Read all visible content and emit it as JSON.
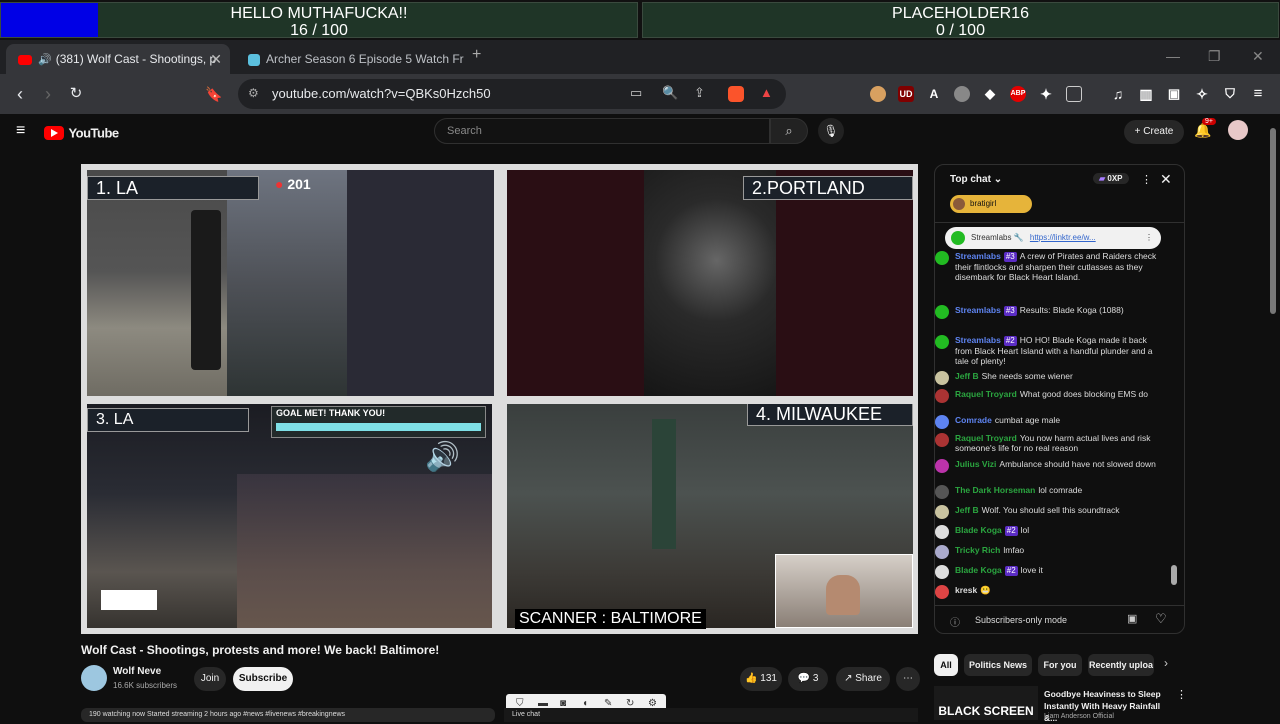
{
  "goals": [
    {
      "title": "HELLO MUTHAFUCKA!!",
      "progress": "16 / 100",
      "fraction": 0.16
    },
    {
      "title": "PLACEHOLDER16",
      "progress": "0 / 100",
      "fraction": 0.0
    }
  ],
  "tabs": [
    {
      "label": "(381) Wolf Cast - Shootings, p",
      "active": true
    },
    {
      "label": "Archer Season 6 Episode 5 Watch Fre",
      "active": false
    }
  ],
  "tab_new": "+",
  "window_controls": {
    "minimize": "—",
    "restore": "❐",
    "close": "✕"
  },
  "address": {
    "url": "youtube.com/watch?v=QBKs0Hzch50"
  },
  "extension_labels": {
    "ublock": "UD",
    "abp": "ABP"
  },
  "youtube": {
    "logo_text": "YouTube",
    "search_placeholder": "Search",
    "create_label": "Create",
    "notifications_badge": "9+"
  },
  "video": {
    "quadrants": [
      {
        "label": "1. LA",
        "viewer_count": "201"
      },
      {
        "label": "2.PORTLAND"
      },
      {
        "label": "3. LA",
        "goal_banner": "GOAL MET! THANK YOU!"
      },
      {
        "label": "4. MILWAUKEE"
      }
    ],
    "scanner_text": "SCANNER : BALTIMORE",
    "title": "Wolf Cast - Shootings, protests and more! We back! Baltimore!"
  },
  "channel": {
    "name": "Wolf Neve",
    "subscribers": "16.6K subscribers",
    "join_label": "Join",
    "subscribe_label": "Subscribe"
  },
  "actions": {
    "likes": "131",
    "comments": "3",
    "share_label": "Share"
  },
  "description_preview": "190 watching now  Started streaming 2 hours ago  #news #livenews #breakingnews",
  "live_chat_tab": "Live chat",
  "chat": {
    "header": "Top chat",
    "points": "0XP",
    "pinned_user": "bratigirl",
    "pinned_message": {
      "author": "Streamlabs",
      "text": "https://linktr.ee/w..."
    },
    "messages": [
      {
        "author": "Streamlabs",
        "badge": "#3",
        "text": "A crew of Pirates and Raiders check their flintlocks and sharpen their cutlasses as they disembark for Black Heart Island.",
        "color": "blue"
      },
      {
        "author": "Streamlabs",
        "badge": "#3",
        "text": "Results: Blade Koga (1088)",
        "color": "blue"
      },
      {
        "author": "Streamlabs",
        "badge": "#2",
        "text": "HO HO! Blade Koga made it back from Black Heart Island with a handful plunder and a tale of plenty!",
        "color": "blue"
      },
      {
        "author": "Jeff B",
        "badge": "",
        "text": "She needs some wiener",
        "color": "green"
      },
      {
        "author": "Raquel Troyard",
        "badge": "",
        "text": "What good does blocking EMS do",
        "color": "green"
      },
      {
        "author": "Comrade",
        "badge": "",
        "text": "cumbat age male",
        "color": "blue"
      },
      {
        "author": "Raquel Troyard",
        "badge": "",
        "text": "You now harm actual lives and risk someone's life for no real reason",
        "color": "green"
      },
      {
        "author": "Julius Vizi",
        "badge": "",
        "text": "Ambulance should have not slowed down",
        "color": "green"
      },
      {
        "author": "The Dark Horseman",
        "badge": "",
        "text": "lol comrade",
        "color": "green"
      },
      {
        "author": "Jeff B",
        "badge": "",
        "text": "Wolf. You should sell this soundtrack",
        "color": "green"
      },
      {
        "author": "Blade Koga",
        "badge": "#2",
        "text": "lol",
        "color": "green"
      },
      {
        "author": "Tricky Rich",
        "badge": "",
        "text": "lmfao",
        "color": "green"
      },
      {
        "author": "Blade Koga",
        "badge": "#2",
        "text": "love it",
        "color": "green"
      },
      {
        "author": "kresk",
        "badge": "",
        "text": "😬",
        "color": "plain"
      }
    ],
    "footer": "Subscribers-only mode"
  },
  "chips": [
    "All",
    "Politics News",
    "For you",
    "Recently uploa"
  ],
  "recommendation": {
    "title": "Goodbye Heaviness to Sleep Instantly With Heavy Rainfall &...",
    "channel": "Liam Anderson Official",
    "thumb_text": "BLACK SCREEN"
  },
  "colors": {
    "accent_red": "#ff0000",
    "goal_fill": "#0000e6",
    "subscribe_bg": "#f1f1f1"
  }
}
